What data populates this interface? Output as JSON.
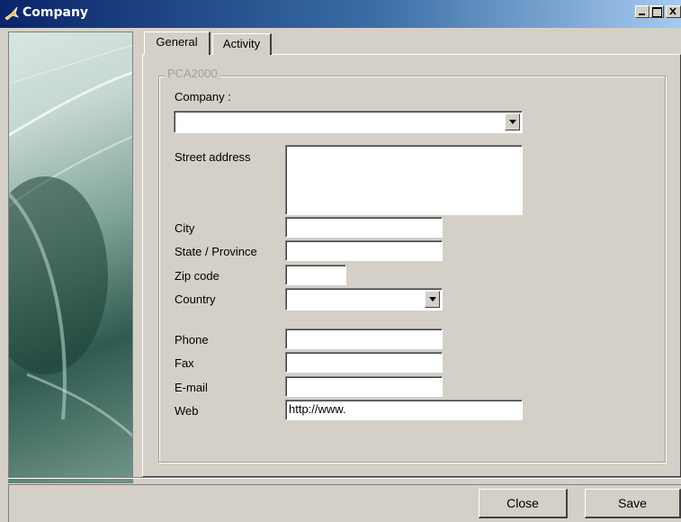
{
  "window": {
    "title": "Company"
  },
  "tabs": [
    {
      "label": "General"
    },
    {
      "label": "Activity"
    }
  ],
  "group": {
    "legend": "PCA2000"
  },
  "form": {
    "company_label": "Company :",
    "company_value": "",
    "street_label": "Street address",
    "street_value": "",
    "city_label": "City",
    "city_value": "",
    "state_label": "State / Province",
    "state_value": "",
    "zip_label": "Zip code",
    "zip_value": "",
    "country_label": "Country",
    "country_value": "",
    "phone_label": "Phone",
    "phone_value": "",
    "fax_label": "Fax",
    "fax_value": "",
    "email_label": "E-mail",
    "email_value": "",
    "web_label": "Web",
    "web_value": "http://www."
  },
  "buttons": {
    "close": "Close",
    "save": "Save"
  },
  "colors": {
    "titlebar_start": "#0a246a",
    "titlebar_end": "#a6caf0",
    "face": "#d4d0c8"
  }
}
